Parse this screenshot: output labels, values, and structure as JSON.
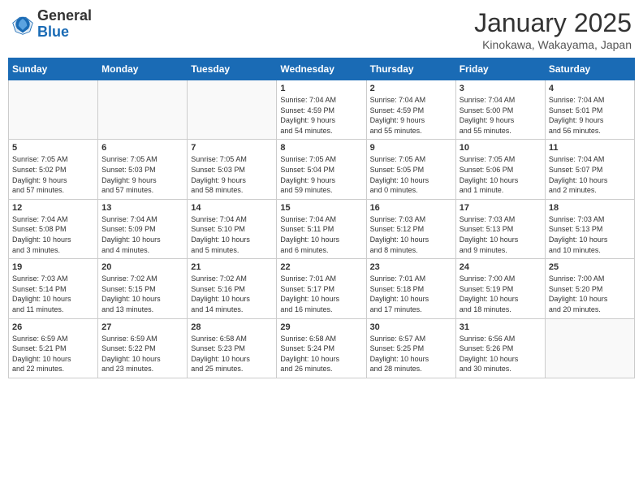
{
  "header": {
    "logo_general": "General",
    "logo_blue": "Blue",
    "month_title": "January 2025",
    "location": "Kinokawa, Wakayama, Japan"
  },
  "days_of_week": [
    "Sunday",
    "Monday",
    "Tuesday",
    "Wednesday",
    "Thursday",
    "Friday",
    "Saturday"
  ],
  "weeks": [
    [
      {
        "day": "",
        "info": ""
      },
      {
        "day": "",
        "info": ""
      },
      {
        "day": "",
        "info": ""
      },
      {
        "day": "1",
        "info": "Sunrise: 7:04 AM\nSunset: 4:59 PM\nDaylight: 9 hours\nand 54 minutes."
      },
      {
        "day": "2",
        "info": "Sunrise: 7:04 AM\nSunset: 4:59 PM\nDaylight: 9 hours\nand 55 minutes."
      },
      {
        "day": "3",
        "info": "Sunrise: 7:04 AM\nSunset: 5:00 PM\nDaylight: 9 hours\nand 55 minutes."
      },
      {
        "day": "4",
        "info": "Sunrise: 7:04 AM\nSunset: 5:01 PM\nDaylight: 9 hours\nand 56 minutes."
      }
    ],
    [
      {
        "day": "5",
        "info": "Sunrise: 7:05 AM\nSunset: 5:02 PM\nDaylight: 9 hours\nand 57 minutes."
      },
      {
        "day": "6",
        "info": "Sunrise: 7:05 AM\nSunset: 5:03 PM\nDaylight: 9 hours\nand 57 minutes."
      },
      {
        "day": "7",
        "info": "Sunrise: 7:05 AM\nSunset: 5:03 PM\nDaylight: 9 hours\nand 58 minutes."
      },
      {
        "day": "8",
        "info": "Sunrise: 7:05 AM\nSunset: 5:04 PM\nDaylight: 9 hours\nand 59 minutes."
      },
      {
        "day": "9",
        "info": "Sunrise: 7:05 AM\nSunset: 5:05 PM\nDaylight: 10 hours\nand 0 minutes."
      },
      {
        "day": "10",
        "info": "Sunrise: 7:05 AM\nSunset: 5:06 PM\nDaylight: 10 hours\nand 1 minute."
      },
      {
        "day": "11",
        "info": "Sunrise: 7:04 AM\nSunset: 5:07 PM\nDaylight: 10 hours\nand 2 minutes."
      }
    ],
    [
      {
        "day": "12",
        "info": "Sunrise: 7:04 AM\nSunset: 5:08 PM\nDaylight: 10 hours\nand 3 minutes."
      },
      {
        "day": "13",
        "info": "Sunrise: 7:04 AM\nSunset: 5:09 PM\nDaylight: 10 hours\nand 4 minutes."
      },
      {
        "day": "14",
        "info": "Sunrise: 7:04 AM\nSunset: 5:10 PM\nDaylight: 10 hours\nand 5 minutes."
      },
      {
        "day": "15",
        "info": "Sunrise: 7:04 AM\nSunset: 5:11 PM\nDaylight: 10 hours\nand 6 minutes."
      },
      {
        "day": "16",
        "info": "Sunrise: 7:03 AM\nSunset: 5:12 PM\nDaylight: 10 hours\nand 8 minutes."
      },
      {
        "day": "17",
        "info": "Sunrise: 7:03 AM\nSunset: 5:13 PM\nDaylight: 10 hours\nand 9 minutes."
      },
      {
        "day": "18",
        "info": "Sunrise: 7:03 AM\nSunset: 5:13 PM\nDaylight: 10 hours\nand 10 minutes."
      }
    ],
    [
      {
        "day": "19",
        "info": "Sunrise: 7:03 AM\nSunset: 5:14 PM\nDaylight: 10 hours\nand 11 minutes."
      },
      {
        "day": "20",
        "info": "Sunrise: 7:02 AM\nSunset: 5:15 PM\nDaylight: 10 hours\nand 13 minutes."
      },
      {
        "day": "21",
        "info": "Sunrise: 7:02 AM\nSunset: 5:16 PM\nDaylight: 10 hours\nand 14 minutes."
      },
      {
        "day": "22",
        "info": "Sunrise: 7:01 AM\nSunset: 5:17 PM\nDaylight: 10 hours\nand 16 minutes."
      },
      {
        "day": "23",
        "info": "Sunrise: 7:01 AM\nSunset: 5:18 PM\nDaylight: 10 hours\nand 17 minutes."
      },
      {
        "day": "24",
        "info": "Sunrise: 7:00 AM\nSunset: 5:19 PM\nDaylight: 10 hours\nand 18 minutes."
      },
      {
        "day": "25",
        "info": "Sunrise: 7:00 AM\nSunset: 5:20 PM\nDaylight: 10 hours\nand 20 minutes."
      }
    ],
    [
      {
        "day": "26",
        "info": "Sunrise: 6:59 AM\nSunset: 5:21 PM\nDaylight: 10 hours\nand 22 minutes."
      },
      {
        "day": "27",
        "info": "Sunrise: 6:59 AM\nSunset: 5:22 PM\nDaylight: 10 hours\nand 23 minutes."
      },
      {
        "day": "28",
        "info": "Sunrise: 6:58 AM\nSunset: 5:23 PM\nDaylight: 10 hours\nand 25 minutes."
      },
      {
        "day": "29",
        "info": "Sunrise: 6:58 AM\nSunset: 5:24 PM\nDaylight: 10 hours\nand 26 minutes."
      },
      {
        "day": "30",
        "info": "Sunrise: 6:57 AM\nSunset: 5:25 PM\nDaylight: 10 hours\nand 28 minutes."
      },
      {
        "day": "31",
        "info": "Sunrise: 6:56 AM\nSunset: 5:26 PM\nDaylight: 10 hours\nand 30 minutes."
      },
      {
        "day": "",
        "info": ""
      }
    ]
  ]
}
